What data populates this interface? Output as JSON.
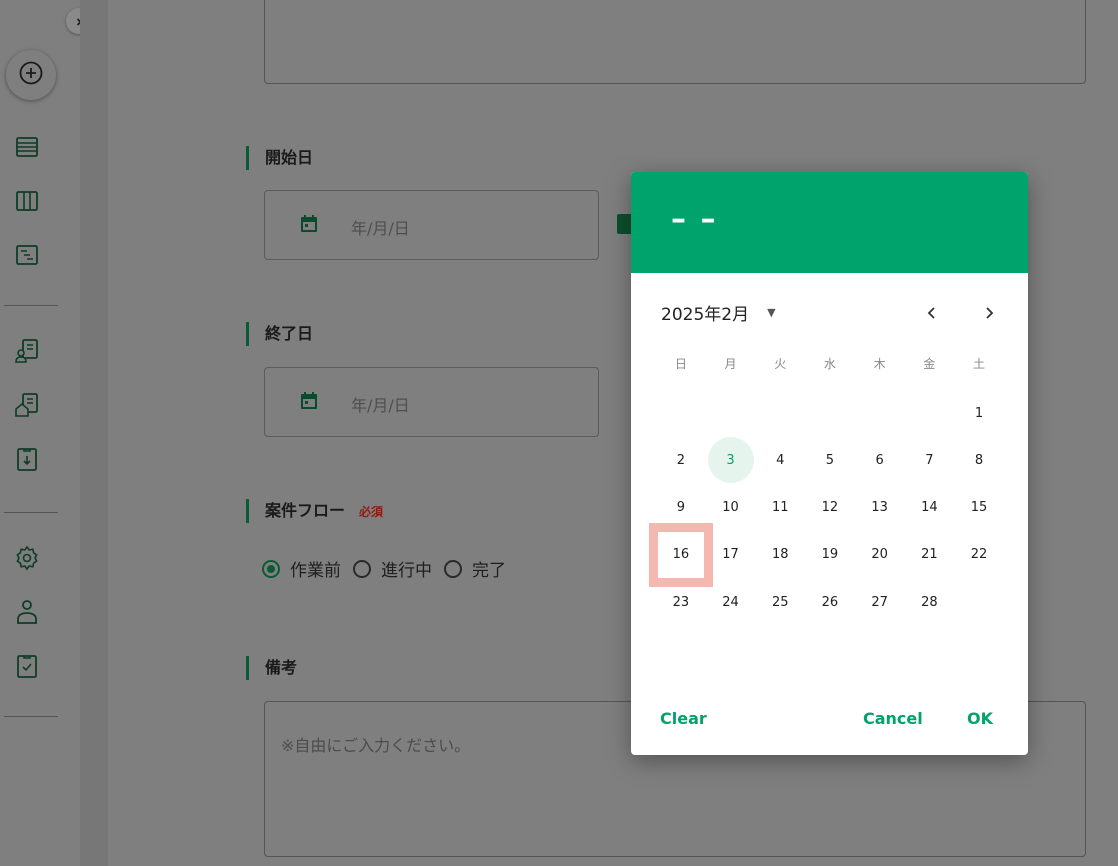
{
  "sidebar": {
    "expand_icon": "chevron-right-icon",
    "add_icon": "plus-circle-icon",
    "items": [
      {
        "icon": "list-view-icon"
      },
      {
        "icon": "columns-view-icon"
      },
      {
        "icon": "gantt-view-icon"
      },
      {
        "icon": "user-document-icon"
      },
      {
        "icon": "house-document-icon"
      },
      {
        "icon": "download-clipboard-icon"
      },
      {
        "icon": "gear-icon"
      },
      {
        "icon": "user-icon"
      },
      {
        "icon": "check-clipboard-icon"
      }
    ]
  },
  "form": {
    "start_date": {
      "label": "開始日",
      "placeholder": "年/月/日"
    },
    "end_date": {
      "label": "終了日",
      "placeholder": "年/月/日"
    },
    "flow": {
      "label": "案件フロー",
      "required": "必須",
      "options": [
        "作業前",
        "進行中",
        "完了"
      ],
      "selected": "作業前"
    },
    "memo": {
      "label": "備考",
      "placeholder": "※自由にご入力ください。"
    }
  },
  "picker": {
    "header_value": "– –",
    "month_label": "2025年2月",
    "weekdays": [
      "日",
      "月",
      "火",
      "水",
      "木",
      "金",
      "土"
    ],
    "first_weekday_index": 6,
    "days_in_month": 28,
    "today": 3,
    "highlighted": 16,
    "clear_label": "Clear",
    "cancel_label": "Cancel",
    "ok_label": "OK",
    "colors": {
      "accent": "#00a36b",
      "highlight": "#f5b8b0"
    }
  }
}
